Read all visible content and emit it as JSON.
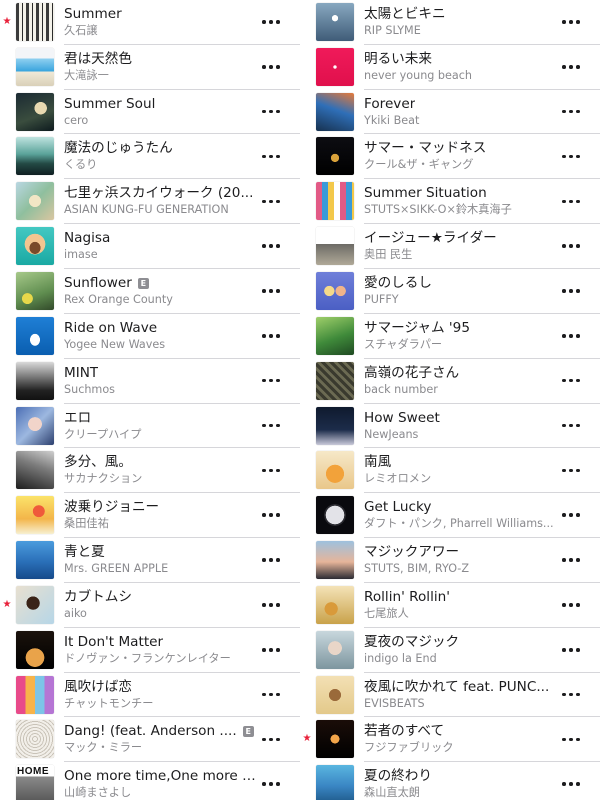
{
  "left": [
    {
      "title": "Summer",
      "artist": "久石譲",
      "starred": true,
      "explicit": false,
      "art": "summer-art"
    },
    {
      "title": "君は天然色",
      "artist": "大滝詠一",
      "starred": false,
      "explicit": false,
      "art": "long-vacation-art"
    },
    {
      "title": "Summer Soul",
      "artist": "cero",
      "starred": false,
      "explicit": false,
      "art": "summer-soul-art"
    },
    {
      "title": "魔法のじゅうたん",
      "artist": "くるり",
      "starred": false,
      "explicit": false,
      "art": "mahou-art"
    },
    {
      "title": "七里ヶ浜スカイウォーク (20...",
      "artist": "ASIAN KUNG-FU GENERATION",
      "starred": false,
      "explicit": false,
      "art": "shichirigahama-art"
    },
    {
      "title": "Nagisa",
      "artist": "imase",
      "starred": false,
      "explicit": false,
      "art": "nagisa-art"
    },
    {
      "title": "Sunflower",
      "artist": "Rex Orange County",
      "starred": false,
      "explicit": true,
      "art": "sunflower-art"
    },
    {
      "title": "Ride on Wave",
      "artist": "Yogee New Waves",
      "starred": false,
      "explicit": false,
      "art": "ride-on-wave-art"
    },
    {
      "title": "MINT",
      "artist": "Suchmos",
      "starred": false,
      "explicit": false,
      "art": "mint-art"
    },
    {
      "title": "エロ",
      "artist": "クリープハイプ",
      "starred": false,
      "explicit": false,
      "art": "ero-art"
    },
    {
      "title": "多分、風。",
      "artist": "サカナクション",
      "starred": false,
      "explicit": false,
      "art": "tabun-kaze-art"
    },
    {
      "title": "波乗りジョニー",
      "artist": "桑田佳祐",
      "starred": false,
      "explicit": false,
      "art": "naminori-art"
    },
    {
      "title": "青と夏",
      "artist": "Mrs. GREEN APPLE",
      "starred": false,
      "explicit": false,
      "art": "ao-to-natsu-art"
    },
    {
      "title": "カブトムシ",
      "artist": "aiko",
      "starred": true,
      "explicit": false,
      "art": "kabutomushi-art"
    },
    {
      "title": "It Don't Matter",
      "artist": "ドノヴァン・フランケンレイター",
      "starred": false,
      "explicit": false,
      "art": "it-dont-matter-art"
    },
    {
      "title": "風吹けば恋",
      "artist": "チャットモンチー",
      "starred": false,
      "explicit": false,
      "art": "kazefukeba-art"
    },
    {
      "title": "Dang! (feat. Anderson ....",
      "artist": "マック・ミラー",
      "starred": false,
      "explicit": true,
      "art": "dang-art"
    },
    {
      "title": "One more time,One more c...",
      "artist": "山崎まさよし",
      "starred": false,
      "explicit": false,
      "art": "home-art",
      "art_text": "HOME"
    }
  ],
  "right": [
    {
      "title": "太陽とビキニ",
      "artist": "RIP SLYME",
      "starred": false,
      "explicit": false,
      "art": "taiyou-art"
    },
    {
      "title": "明るい未来",
      "artist": "never young beach",
      "starred": false,
      "explicit": false,
      "art": "akarui-mirai-art"
    },
    {
      "title": "Forever",
      "artist": "Ykiki Beat",
      "starred": false,
      "explicit": false,
      "art": "forever-art"
    },
    {
      "title": "サマー・マッドネス",
      "artist": "クール&ザ・ギャング",
      "starred": false,
      "explicit": false,
      "art": "summer-madness-art"
    },
    {
      "title": "Summer Situation",
      "artist": "STUTS×SIKK-O×鈴木真海子",
      "starred": false,
      "explicit": false,
      "art": "allseason-art"
    },
    {
      "title": "イージュー★ライダー",
      "artist": "奥田 民生",
      "starred": false,
      "explicit": false,
      "art": "easy-rider-art"
    },
    {
      "title": "愛のしるし",
      "artist": "PUFFY",
      "starred": false,
      "explicit": false,
      "art": "ai-no-shirushi-art"
    },
    {
      "title": "サマージャム '95",
      "artist": "スチャダラパー",
      "starred": false,
      "explicit": false,
      "art": "summer-jam-art"
    },
    {
      "title": "高嶺の花子さん",
      "artist": "back number",
      "starred": false,
      "explicit": false,
      "art": "takane-art"
    },
    {
      "title": "How Sweet",
      "artist": "NewJeans",
      "starred": false,
      "explicit": false,
      "art": "how-sweet-art"
    },
    {
      "title": "南風",
      "artist": "レミオロメン",
      "starred": false,
      "explicit": false,
      "art": "minamikaze-art"
    },
    {
      "title": "Get Lucky",
      "artist": "ダフト・パンク, Pharrell Williams...",
      "starred": false,
      "explicit": false,
      "art": "get-lucky-art"
    },
    {
      "title": "マジックアワー",
      "artist": "STUTS, BIM, RYO-Z",
      "starred": false,
      "explicit": false,
      "art": "magic-hour-art"
    },
    {
      "title": "Rollin' Rollin'",
      "artist": "七尾旅人",
      "starred": false,
      "explicit": false,
      "art": "rollin-art"
    },
    {
      "title": "夏夜のマジック",
      "artist": "indigo la End",
      "starred": false,
      "explicit": false,
      "art": "natsuyo-art"
    },
    {
      "title": "夜風に吹かれて feat. PUNC...",
      "artist": "EVISBEATS",
      "starred": false,
      "explicit": false,
      "art": "yokaze-art"
    },
    {
      "title": "若者のすべて",
      "artist": "フジファブリック",
      "starred": true,
      "explicit": false,
      "art": "wakamono-art"
    },
    {
      "title": "夏の終わり",
      "artist": "森山直太朗",
      "starred": false,
      "explicit": false,
      "art": "natsu-no-owari-art"
    }
  ],
  "explicit_label": "E",
  "star_glyph": "★",
  "colors": {
    "star": "#e8213a",
    "title": "#1c1c1e",
    "subtitle": "#8a8a8e",
    "separator": "#d6d6da",
    "explicit_badge": "#8e8e93"
  }
}
